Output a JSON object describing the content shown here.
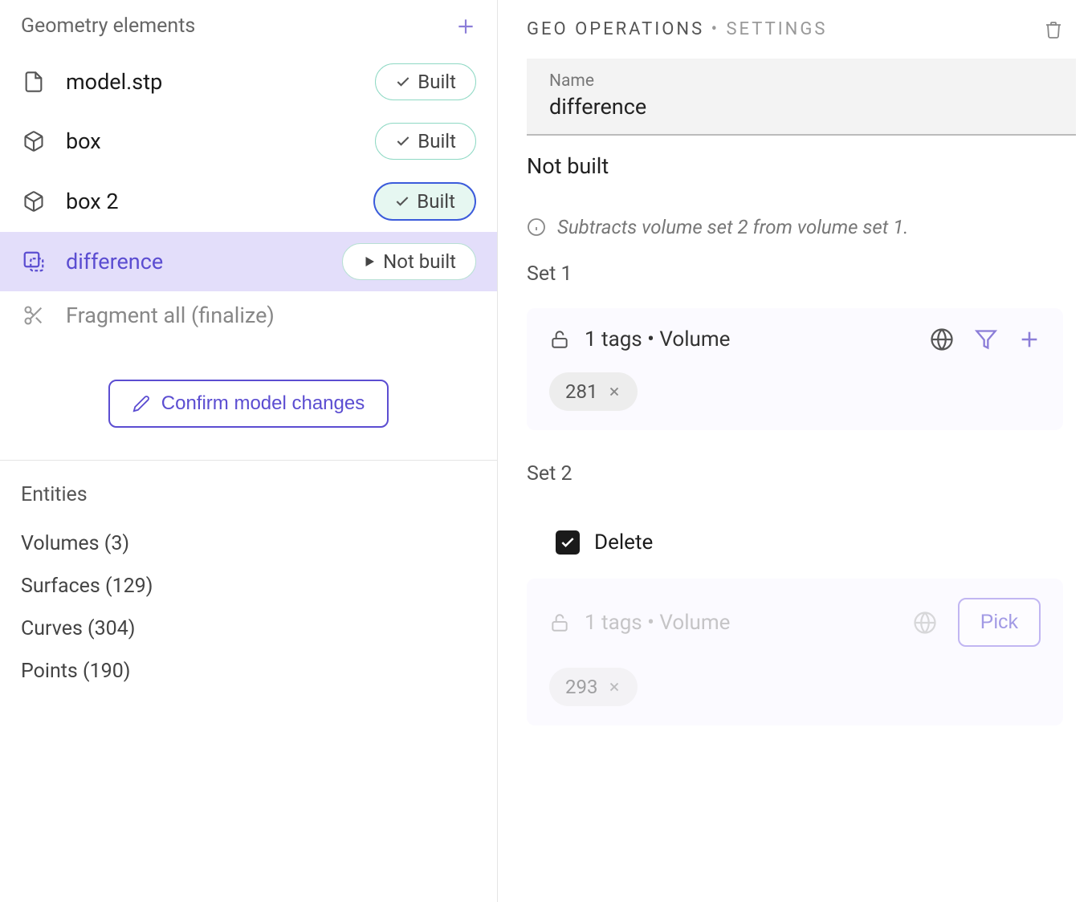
{
  "left": {
    "header": "Geometry elements",
    "elements": [
      {
        "label": "model.stp",
        "status": "Built",
        "icon": "file"
      },
      {
        "label": "box",
        "status": "Built",
        "icon": "cube"
      },
      {
        "label": "box 2",
        "status": "Built",
        "icon": "cube",
        "active": true
      },
      {
        "label": "difference",
        "status": "Not built",
        "icon": "diff",
        "selected": true
      },
      {
        "label": "Fragment all (finalize)",
        "status": "",
        "icon": "scissors",
        "dimmed": true
      }
    ],
    "confirm_label": "Confirm model changes",
    "entities": {
      "title": "Entities",
      "rows": [
        "Volumes (3)",
        "Surfaces (129)",
        "Curves (304)",
        "Points (190)"
      ]
    }
  },
  "right": {
    "breadcrumb_a": "GEO OPERATIONS",
    "breadcrumb_sep": " • ",
    "breadcrumb_b": "SETTINGS",
    "name_label": "Name",
    "name_value": "difference",
    "status": "Not built",
    "info": "Subtracts volume set 2 from volume set 1.",
    "set1": {
      "label": "Set 1",
      "tags_text": "1 tags • Volume",
      "tag": "281"
    },
    "set2": {
      "label": "Set 2",
      "delete_label": "Delete",
      "tags_text": "1 tags • Volume",
      "tag": "293",
      "pick_label": "Pick"
    }
  }
}
